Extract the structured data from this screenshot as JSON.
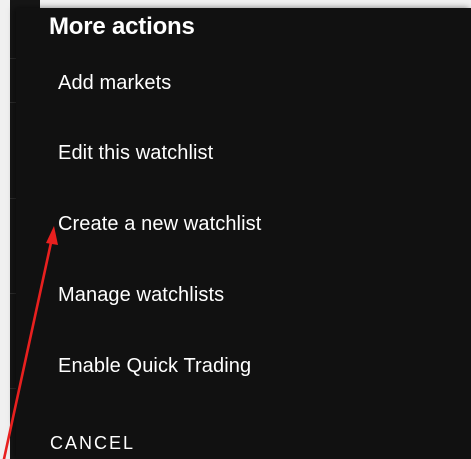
{
  "sheet": {
    "title": "More actions",
    "items": [
      {
        "label": "Add markets"
      },
      {
        "label": "Edit this watchlist"
      },
      {
        "label": "Create a new watchlist"
      },
      {
        "label": "Manage watchlists"
      },
      {
        "label": "Enable Quick Trading"
      }
    ],
    "cancel_label": "CANCEL"
  },
  "colors": {
    "sheet_background": "#111111",
    "text": "#ffffff",
    "annotation_arrow": "#e8201f",
    "page_background": "#f0f0f0"
  },
  "annotation": {
    "icon": "red-arrow-icon",
    "points_to": "Create a new watchlist"
  }
}
